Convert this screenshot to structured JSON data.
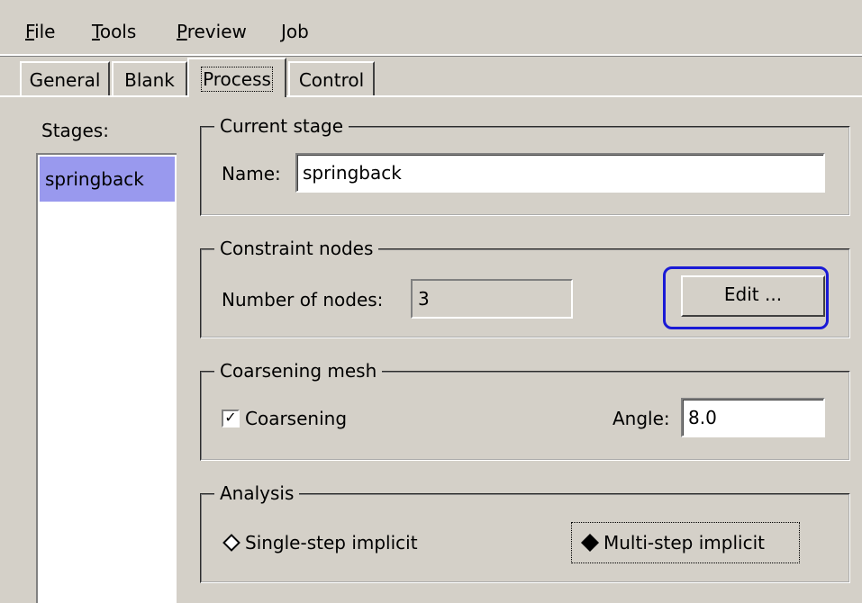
{
  "menu": {
    "items": [
      {
        "label": "File",
        "mnemonic": "F",
        "rest": "ile"
      },
      {
        "label": "Tools",
        "mnemonic": "T",
        "rest": "ools"
      },
      {
        "label": "Preview",
        "mnemonic": "P",
        "rest": "review"
      },
      {
        "label": "Job",
        "mnemonic": "J",
        "rest": "ob"
      }
    ]
  },
  "tabs": [
    {
      "label": "General"
    },
    {
      "label": "Blank"
    },
    {
      "label": "Process"
    },
    {
      "label": "Control"
    }
  ],
  "selected_tab": "Process",
  "stages": {
    "label": "Stages:",
    "items": [
      "springback"
    ],
    "selected": "springback"
  },
  "current_stage": {
    "legend": "Current stage",
    "name_label": "Name:",
    "name_value": "springback"
  },
  "constraint_nodes": {
    "legend": "Constraint nodes",
    "count_label": "Number of nodes:",
    "count_value": "3",
    "edit_label": "Edit ..."
  },
  "coarsening": {
    "legend": "Coarsening mesh",
    "checkbox_label": "Coarsening",
    "checked": true,
    "check_mark": "✓",
    "angle_label": "Angle:",
    "angle_value": "8.0"
  },
  "analysis": {
    "legend": "Analysis",
    "options": [
      "Single-step implicit",
      "Multi-step implicit"
    ],
    "selected": "Multi-step implicit"
  },
  "colors": {
    "background": "#d4d0c8",
    "selection": "#9999ee",
    "highlight": "#1a1ad6"
  }
}
